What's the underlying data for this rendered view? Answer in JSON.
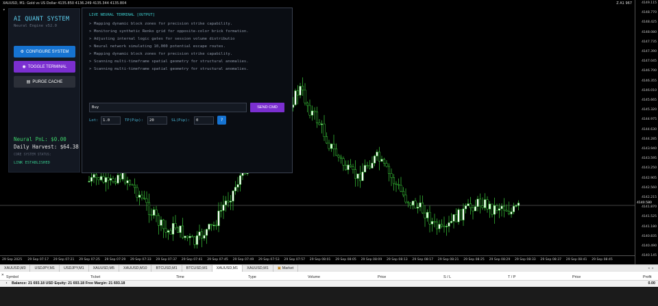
{
  "chart": {
    "title": "XAUUSD, M1: Gold vs US Dollar  4135.850 4136.249 4135.344 4135.804",
    "top_right": "Z A1 967",
    "price_labels": [
      "4149.115",
      "4148.770",
      "4148.425",
      "4148.080",
      "4147.735",
      "4147.390",
      "4147.045",
      "4146.700",
      "4146.355",
      "4146.010",
      "4145.665",
      "4145.320",
      "4144.975",
      "4144.630",
      "4144.285",
      "4143.940",
      "4143.595",
      "4143.250",
      "4142.905",
      "4142.560",
      "4142.215",
      "4141.870",
      "4141.525",
      "4141.180",
      "4140.835",
      "4140.490",
      "4140.145"
    ],
    "current_price": "4140.580",
    "time_labels": [
      "29 Sep 2025",
      "29 Sep 07:17",
      "29 Sep 07:21",
      "29 Sep 07:25",
      "29 Sep 07:29",
      "29 Sep 07:33",
      "29 Sep 07:37",
      "29 Sep 07:41",
      "29 Sep 07:45",
      "29 Sep 07:49",
      "29 Sep 07:53",
      "29 Sep 07:57",
      "29 Sep 08:01",
      "29 Sep 08:05",
      "29 Sep 08:09",
      "29 Sep 08:13",
      "29 Sep 08:17",
      "29 Sep 08:21",
      "29 Sep 08:25",
      "29 Sep 08:29",
      "29 Sep 08:33",
      "29 Sep 08:37",
      "29 Sep 08:41",
      "29 Sep 08:45"
    ],
    "colors": {
      "bull": "#ffffff",
      "bear": "#000000",
      "wick": "#3cd13c",
      "grid": "#555555"
    }
  },
  "chart_data": {
    "type": "candlestick",
    "symbol": "XAUUSD",
    "timeframe": "M1",
    "ylim": [
      4140.145,
      4149.115
    ]
  },
  "sidebar": {
    "title": "AI QUANT SYSTEM",
    "subtitle": "Neural Engine v52.0",
    "configure_label": "CONFIGURE SYSTEM",
    "toggle_label": "TOGGLE TERMINAL",
    "purge_label": "PURGE CACHE",
    "pnl": "Neural PnL: $0.00",
    "harvest": "Daily Harvest: $64.38",
    "status_label": "CORE SYSTEM STATUS:",
    "status": "LINK ESTABLISHED"
  },
  "terminal": {
    "title": "LIVE NEURAL TERMINAL [OUTPUT]",
    "log": [
      "Mapping dynamic block zones for precision strike capability.",
      "Monitoring synthetic Renko grid for opposite-color brick formation.",
      "Adjusting internal logic gates for session volume distributio",
      "Neural network simulating 10,000 potential escape routes.",
      "Mapping dynamic block zones for precision strike capability.",
      "Scanning multi-timeframe spatial geometry for structural anomalies.",
      "Scanning multi-timeframe spatial geometry for structural anomalies."
    ],
    "command_value": "Buy",
    "send_label": "SEND CMD",
    "lot_label": "Lot:",
    "lot_value": "1.0",
    "tp_label": "TP(Pip):",
    "tp_value": "20",
    "sl_label": "SL(Pip):",
    "sl_value": "0",
    "help_label": "?"
  },
  "tabs": [
    {
      "label": "XAUUSD,M3",
      "active": false
    },
    {
      "label": "USDJPY,M1",
      "active": false
    },
    {
      "label": "USDJPY,M1",
      "active": false
    },
    {
      "label": "XAUUSD,M5",
      "active": false
    },
    {
      "label": "XAUUSD,M10",
      "active": false
    },
    {
      "label": "BTCUSD,M1",
      "active": false
    },
    {
      "label": "BTCUSD,M1",
      "active": false
    },
    {
      "label": "XAUUSD,M1",
      "active": true
    },
    {
      "label": "XAUUSD,M1",
      "active": false
    }
  ],
  "market_tab": "Market",
  "toolbox": {
    "columns": [
      "Symbol",
      "Ticket",
      "Time",
      "Type",
      "Volume",
      "Price",
      "S / L",
      "T / P",
      "Price",
      "Profit"
    ],
    "balance": "Balance: 21 693.18 USD  Equity: 21 693.18  Free Margin: 21 693.18",
    "profit": "0.00"
  }
}
